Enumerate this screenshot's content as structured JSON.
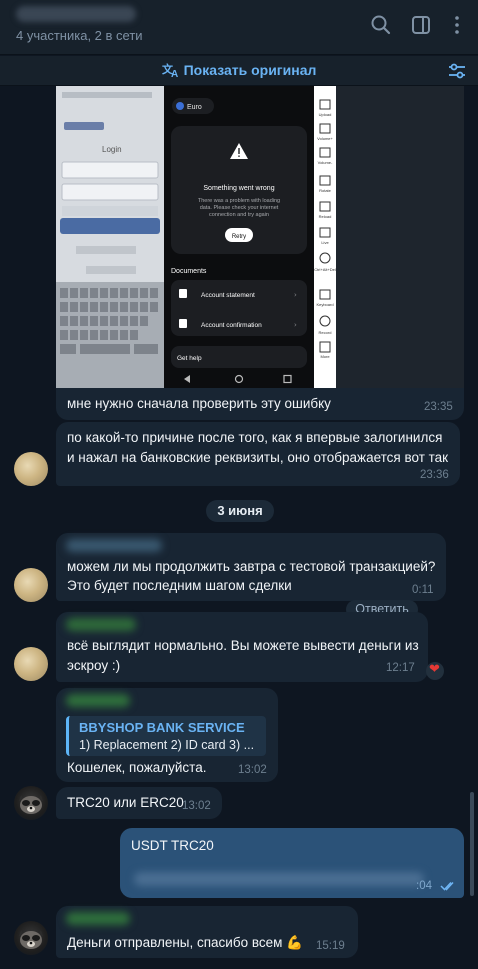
{
  "header": {
    "status": "4 участника, 2 в сети",
    "icons": [
      "search-icon",
      "sidebar-toggle-icon",
      "more-vertical-icon"
    ]
  },
  "translate_bar": {
    "label": "Показать оригинал",
    "icons": [
      "translate-icon",
      "settings-sliders-icon"
    ]
  },
  "screenshot": {
    "currency": "Euro",
    "error_title": "Something went wrong",
    "error_body": [
      "There was a problem with loading",
      "data. Please check your internet",
      "connection and try again"
    ],
    "retry": "Retry",
    "documents_title": "Documents",
    "doc_items": [
      "Account statement",
      "Account confirmation"
    ],
    "help": "Get help",
    "side_tools": [
      "Upload",
      "Volume+",
      "Volume-",
      "Rotate",
      "Reload",
      "Live",
      "Ctrl+Alt+Del",
      "Keyboard",
      "Record",
      "More"
    ],
    "left_login": "Login"
  },
  "messages": [
    {
      "text": "мне нужно сначала проверить эту ошибку",
      "time": "23:35"
    },
    {
      "lines": [
        "по какой-то причине после того, как я впервые залогинился",
        "и нажал на банковские реквизиты, оно отображается вот так"
      ],
      "time": "23:36"
    },
    {
      "lines": [
        "можем ли мы продолжить завтра с тестовой транзакцией?",
        "Это будет последним шагом сделки"
      ],
      "time": "0:11"
    },
    {
      "lines": [
        "всё выглядит нормально. Вы можете вывести деньги из",
        "эскроу :)"
      ],
      "time": "12:17"
    },
    {
      "reply_title": "BBYSHOP BANK SERVICE",
      "reply_text": "1) Replacement 2) ID card 3) ...",
      "text": "Кошелек, пожалуйста.",
      "time": "13:02"
    },
    {
      "text": "TRC20 или ERC20",
      "time": "13:02"
    },
    {
      "text": "USDT TRC20",
      "time": ":04"
    },
    {
      "text": "Деньги отправлены, спасибо всем 💪",
      "time": "15:19"
    }
  ],
  "date_separator": "3 июня",
  "reply_button": "Ответить",
  "reaction": "❤",
  "colors": {
    "accent": "#6ab3f3",
    "incoming": "#182533",
    "outgoing": "#2b5278",
    "background": "#0e1621"
  }
}
